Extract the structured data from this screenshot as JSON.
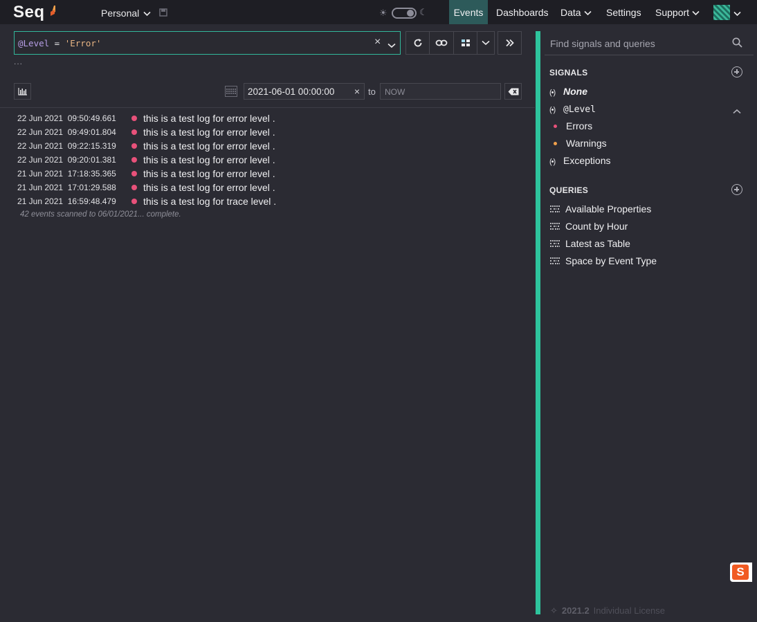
{
  "app": {
    "logo": "Seq"
  },
  "header": {
    "workspace": "Personal",
    "nav": {
      "events": "Events",
      "dashboards": "Dashboards",
      "data": "Data",
      "settings": "Settings",
      "support": "Support"
    }
  },
  "query": {
    "prefix": "@Level",
    "operator": " = ",
    "value": "'Error'"
  },
  "toolbar": {
    "more": "..."
  },
  "range": {
    "from": "2021-06-01 00:00:00",
    "to_label": "to",
    "to_placeholder": "NOW"
  },
  "events": [
    {
      "time": "22 Jun 2021  09:50:49.661",
      "message": "this is a test log for error level ."
    },
    {
      "time": "22 Jun 2021  09:49:01.804",
      "message": "this is a test log for error level ."
    },
    {
      "time": "22 Jun 2021  09:22:15.319",
      "message": "this is a test log for error level ."
    },
    {
      "time": "22 Jun 2021  09:20:01.381",
      "message": "this is a test log for error level ."
    },
    {
      "time": "21 Jun 2021  17:18:35.365",
      "message": "this is a test log for error level ."
    },
    {
      "time": "21 Jun 2021  17:01:29.588",
      "message": "this is a test log for error level ."
    },
    {
      "time": "21 Jun 2021  16:59:48.479",
      "message": "this is a test log for trace level ."
    }
  ],
  "status": "42 events scanned to 06/01/2021... complete.",
  "sidebar": {
    "search_placeholder": "Find signals and queries",
    "signals_heading": "SIGNALS",
    "signals": {
      "none": "None",
      "level": "@Level",
      "errors": "Errors",
      "warnings": "Warnings",
      "exceptions": "Exceptions"
    },
    "queries_heading": "QUERIES",
    "queries": [
      "Available Properties",
      "Count by Hour",
      "Latest as Table",
      "Space by Event Type"
    ]
  },
  "footer": {
    "version": "2021.2",
    "license": "Individual License"
  },
  "colors": {
    "accent": "#2ec49d",
    "error": "#e8517a",
    "warning": "#f0a04b"
  }
}
